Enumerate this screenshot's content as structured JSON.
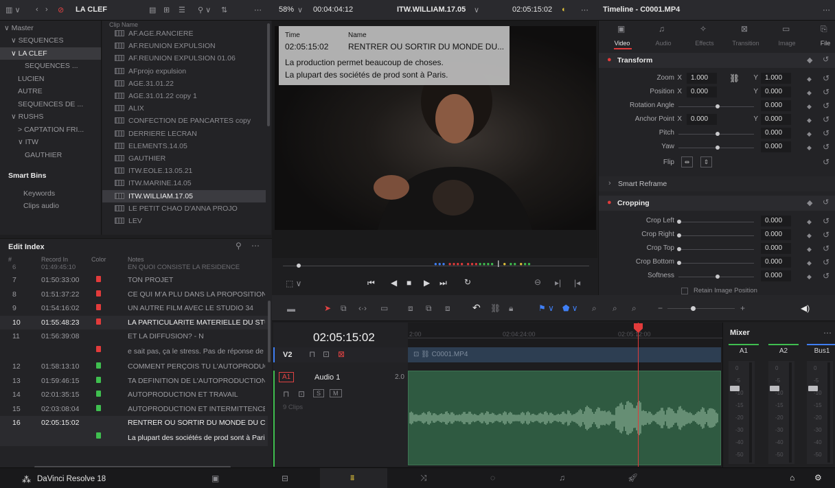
{
  "topbar": {
    "project_label": "LA CLEF",
    "zoom": "58%",
    "timecode_left": "00:04:04:12",
    "clip_name": "ITW.WILLIAM.17.05",
    "timecode_right": "02:05:15:02",
    "timeline_title": "Timeline - C0001.MP4"
  },
  "bins": {
    "master_label": "Master",
    "items": [
      {
        "label": "SEQUENCES",
        "indent": 1,
        "arrow": "∨"
      },
      {
        "label": "LA CLEF",
        "indent": 1,
        "arrow": "∨",
        "selected": true
      },
      {
        "label": "SEQUENCES ...",
        "indent": 3
      },
      {
        "label": "LUCIEN",
        "indent": 2
      },
      {
        "label": "AUTRE",
        "indent": 2
      },
      {
        "label": "SEQUENCES DE ...",
        "indent": 2
      },
      {
        "label": "RUSHS",
        "indent": 1,
        "arrow": "∨"
      },
      {
        "label": "CAPTATION FRI...",
        "indent": 2,
        "arrow": ">"
      },
      {
        "label": "ITW",
        "indent": 2,
        "arrow": "∨"
      },
      {
        "label": "GAUTHIER",
        "indent": 3
      }
    ],
    "smart_bins_title": "Smart Bins",
    "smart_items": [
      "Keywords",
      "Clips audio"
    ]
  },
  "clips": {
    "header": "Clip Name",
    "items": [
      {
        "name": "AF.AGE.RANCIERE"
      },
      {
        "name": "AF.REUNION EXPULSION"
      },
      {
        "name": "AF.REUNION EXPULSION 01.06"
      },
      {
        "name": "AFprojo expulsion"
      },
      {
        "name": "AGE.31.01.22"
      },
      {
        "name": "AGE.31.01.22 copy 1"
      },
      {
        "name": "ALIX"
      },
      {
        "name": "CONFECTION DE PANCARTES copy"
      },
      {
        "name": "DERRIERE LECRAN"
      },
      {
        "name": "ELEMENTS.14.05"
      },
      {
        "name": "GAUTHIER"
      },
      {
        "name": "ITW.EOLE.13.05.21"
      },
      {
        "name": "ITW.MARINE.14.05"
      },
      {
        "name": "ITW.WILLIAM.17.05",
        "selected": true
      },
      {
        "name": "LE PETIT CHAO D'ANNA PROJO"
      },
      {
        "name": "LEV"
      }
    ]
  },
  "viewer": {
    "overlay_time_header": "Time",
    "overlay_name_header": "Name",
    "overlay_time": "02:05:15:02",
    "overlay_name": "RENTRER OU SORTIR DU MONDE DU...",
    "overlay_line1": "La production permet beaucoup de choses.",
    "overlay_line2": "La plupart des sociétés de prod sont à Paris."
  },
  "inspector": {
    "tabs": [
      "Video",
      "Audio",
      "Effects",
      "Transition",
      "Image",
      "File"
    ],
    "transform_title": "Transform",
    "zoom_label": "Zoom",
    "zoom_x": "1.000",
    "zoom_y": "1.000",
    "position_label": "Position",
    "position_x": "0.000",
    "position_y": "0.000",
    "rotation_label": "Rotation Angle",
    "rotation_value": "0.000",
    "anchor_label": "Anchor Point",
    "anchor_x": "0.000",
    "anchor_y": "0.000",
    "pitch_label": "Pitch",
    "pitch_value": "0.000",
    "yaw_label": "Yaw",
    "yaw_value": "0.000",
    "flip_label": "Flip",
    "smart_reframe": "Smart Reframe",
    "cropping_title": "Cropping",
    "crop_left_label": "Crop Left",
    "crop_left": "0.000",
    "crop_right_label": "Crop Right",
    "crop_right": "0.000",
    "crop_top_label": "Crop Top",
    "crop_top": "0.000",
    "crop_bottom_label": "Crop Bottom",
    "crop_bottom": "0.000",
    "softness_label": "Softness",
    "softness": "0.000",
    "retain_label": "Retain Image Position",
    "x_label": "X",
    "y_label": "Y"
  },
  "edit_index": {
    "title": "Edit Index",
    "col_num": "#",
    "col_record": "Record In",
    "col_color": "Color",
    "col_notes": "Notes",
    "partial_row": {
      "num": "6",
      "record": "01:49:45:10",
      "note": "EN QUOI CONSISTE LA RESIDENCE"
    },
    "rows": [
      {
        "num": "7",
        "record": "01:50:33:00",
        "color": "#e23b3b",
        "note": "TON PROJET"
      },
      {
        "num": "8",
        "record": "01:51:37:22",
        "color": "#e23b3b",
        "note": "CE QUI M'A PLU DANS LA PROPOSITION DU"
      },
      {
        "num": "9",
        "record": "01:54:16:02",
        "color": "#e23b3b",
        "note": "UN AUTRE FILM AVEC LE STUDIO 34"
      },
      {
        "num": "10",
        "record": "01:55:48:23",
        "color": "#e23b3b",
        "note": "LA PARTICULARITE MATERIELLE DU STUDIC",
        "hi": true
      },
      {
        "num": "11",
        "record": "01:56:39:08",
        "color": "#e23b3b",
        "note": "ET LA DIFFUSION? - N",
        "note2": "e sait pas, ça le stress. Pas de réponse de C"
      },
      {
        "num": "12",
        "record": "01:58:13:10",
        "color": "#3fbf4f",
        "note": "COMMENT PERÇOIS TU L'AUTOPRODUCTIC"
      },
      {
        "num": "13",
        "record": "01:59:46:15",
        "color": "#3fbf4f",
        "note": "TA DEFINITION DE L'AUTOPRODUCTION"
      },
      {
        "num": "14",
        "record": "02:01:35:15",
        "color": "#3fbf4f",
        "note": "AUTOPRODUCTION ET TRAVAIL"
      },
      {
        "num": "15",
        "record": "02:03:08:04",
        "color": "#3fbf4f",
        "note": "AUTOPRODUCTION ET INTERMITTENCE"
      },
      {
        "num": "16",
        "record": "02:05:15:02",
        "color": "#3fbf4f",
        "note": "RENTRER OU SORTIR DU MONDE DU CINEN",
        "note2": "La plupart des sociétés de prod sont à Paris",
        "hi": true
      }
    ]
  },
  "timeline": {
    "timecode": "02:05:15:02",
    "ruler_labels": [
      "2:00",
      "02:04:24:00",
      "02:05:12:00"
    ],
    "v2_label": "V2",
    "video_clip": "C0001.MP4",
    "a1_label": "A1",
    "audio_name": "Audio 1",
    "audio_ch": "2.0",
    "s_label": "S",
    "m_label": "M",
    "clips_count": "9 Clips"
  },
  "mixer": {
    "title": "Mixer",
    "channels": [
      "A1",
      "A2",
      "Bus1"
    ],
    "scale": [
      "0",
      "-5",
      "-10",
      "-15",
      "-20",
      "-30",
      "-40",
      "-50"
    ]
  },
  "bottom": {
    "app_name": "DaVinci Resolve 18"
  }
}
